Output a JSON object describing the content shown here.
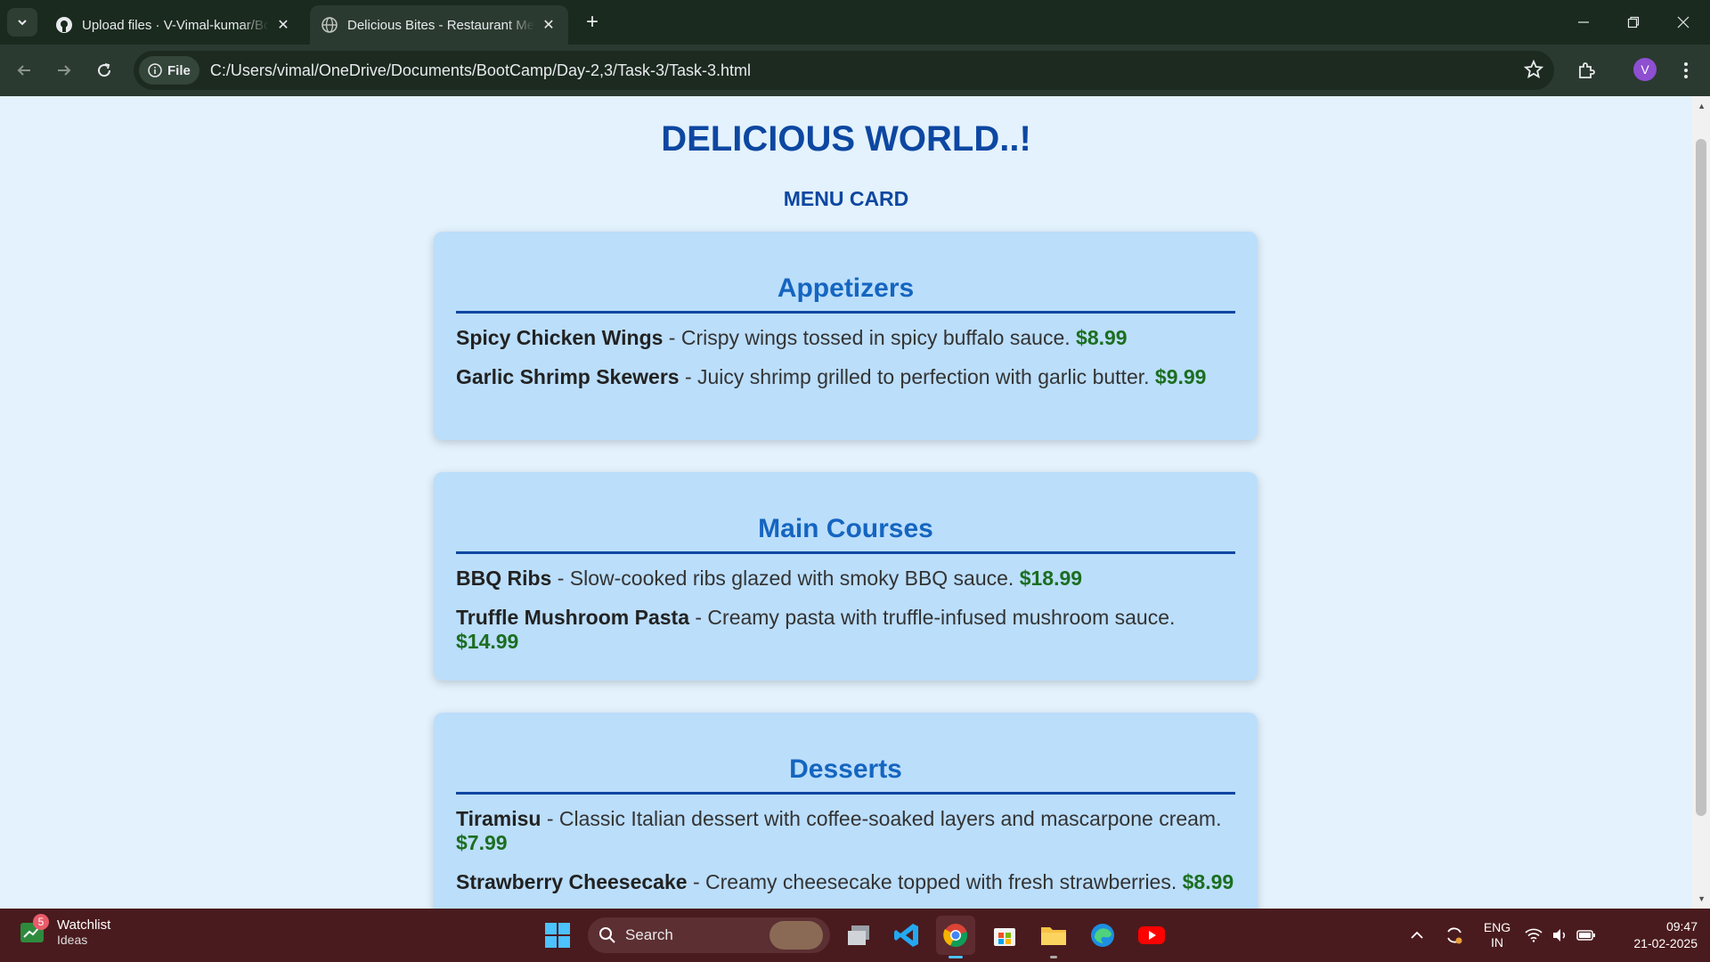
{
  "browser": {
    "tabs": [
      {
        "title": "Upload files · V-Vimal-kumar/Bo",
        "active": false,
        "icon": "github-icon"
      },
      {
        "title": "Delicious Bites - Restaurant Menu",
        "active": true,
        "icon": "globe-icon"
      }
    ],
    "chip_label": "File",
    "url": "C:/Users/vimal/OneDrive/Documents/BootCamp/Day-2,3/Task-3/Task-3.html",
    "profile_initial": "V"
  },
  "page": {
    "title": "DELICIOUS WORLD..!",
    "subtitle": "MENU CARD",
    "sections": [
      {
        "heading": "Appetizers",
        "items": [
          {
            "name": "Spicy Chicken Wings",
            "desc": " - Crispy wings tossed in spicy buffalo sauce. ",
            "price": "$8.99"
          },
          {
            "name": "Garlic Shrimp Skewers",
            "desc": " - Juicy shrimp grilled to perfection with garlic butter. ",
            "price": "$9.99"
          }
        ]
      },
      {
        "heading": "Main Courses",
        "items": [
          {
            "name": "BBQ Ribs",
            "desc": " - Slow-cooked ribs glazed with smoky BBQ sauce. ",
            "price": "$18.99"
          },
          {
            "name": "Truffle Mushroom Pasta",
            "desc": " - Creamy pasta with truffle-infused mushroom sauce. ",
            "price": "$14.99"
          }
        ]
      },
      {
        "heading": "Desserts",
        "items": [
          {
            "name": "Tiramisu",
            "desc": " - Classic Italian dessert with coffee-soaked layers and mascarpone cream. ",
            "price": "$7.99"
          },
          {
            "name": "Strawberry Cheesecake",
            "desc": " - Creamy cheesecake topped with fresh strawberries. ",
            "price": "$8.99"
          }
        ]
      }
    ]
  },
  "taskbar": {
    "watchlist_title": "Watchlist",
    "watchlist_sub": "Ideas",
    "watchlist_badge": "5",
    "search_placeholder": "Search",
    "lang_top": "ENG",
    "lang_bottom": "IN",
    "time": "09:47",
    "date": "21-02-2025"
  },
  "colors": {
    "page_bg": "#e3f2fd",
    "card_bg": "#bbdefb",
    "heading": "#0d47a1",
    "price": "#1b6e20"
  }
}
